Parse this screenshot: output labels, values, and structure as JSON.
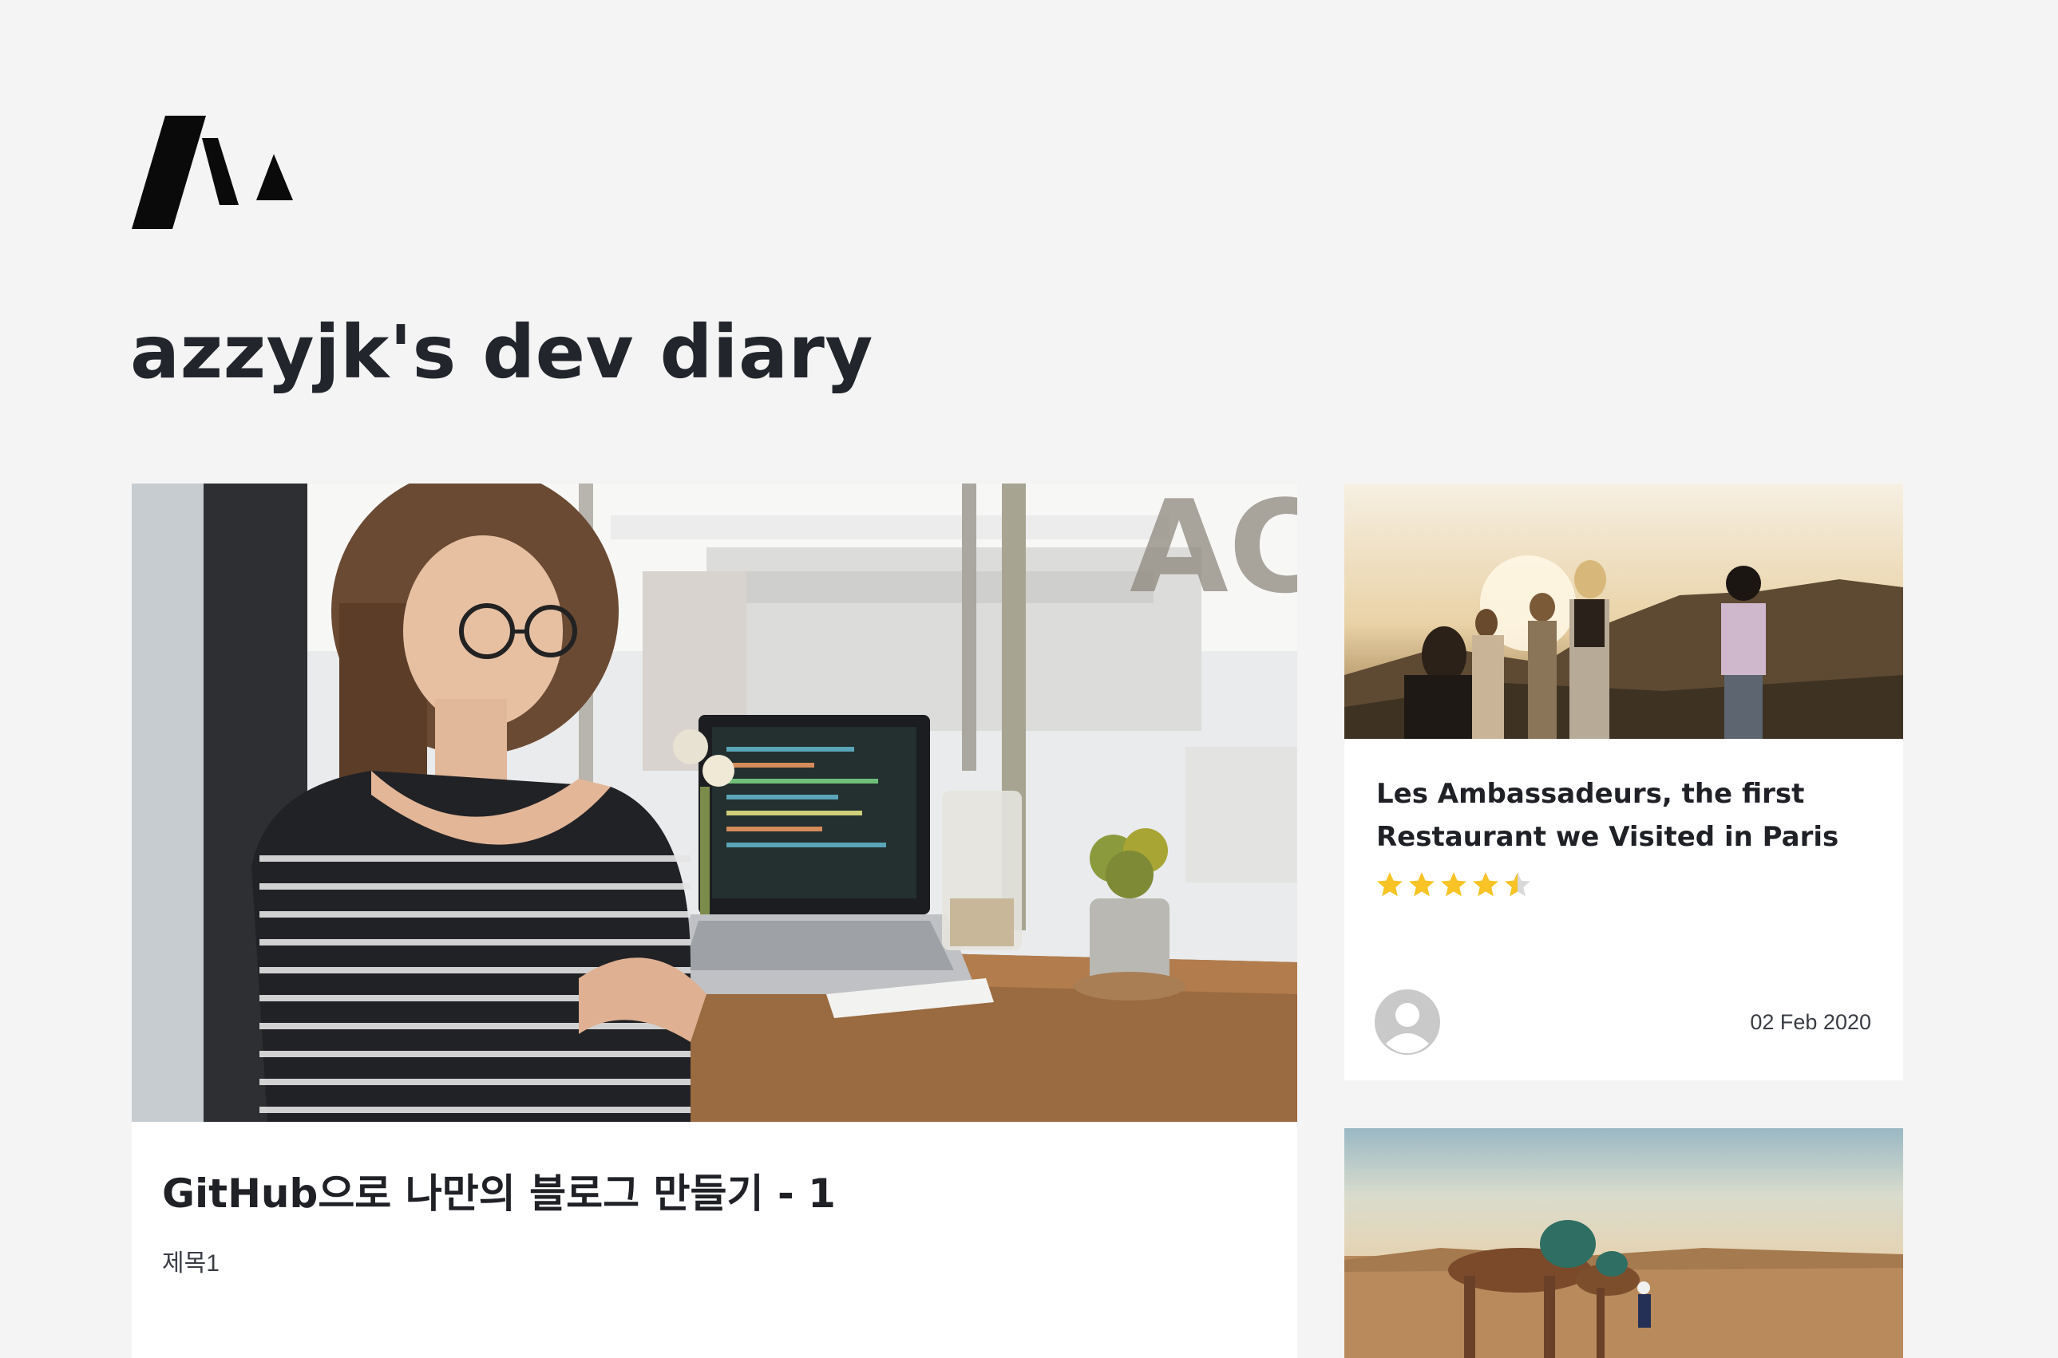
{
  "site": {
    "title": "azzyjk's dev diary",
    "logo_icon": "brand-logo-icon"
  },
  "featured_post": {
    "title": "GitHub으로 나만의 블로그 만들기 - 1",
    "excerpt": "제목1"
  },
  "side_posts": [
    {
      "title": "Les Ambassadeurs, the first Restaurant we Visited in Paris",
      "rating": 4.5,
      "rating_max": 5,
      "date": "02 Feb 2020",
      "author_icon": "user-avatar-icon"
    },
    {
      "title": ""
    }
  ],
  "colors": {
    "background": "#f4f4f4",
    "card": "#ffffff",
    "text": "#22252b",
    "star": "#f7c325",
    "star_empty": "#d9d9d9",
    "avatar": "#c9c9c9"
  }
}
